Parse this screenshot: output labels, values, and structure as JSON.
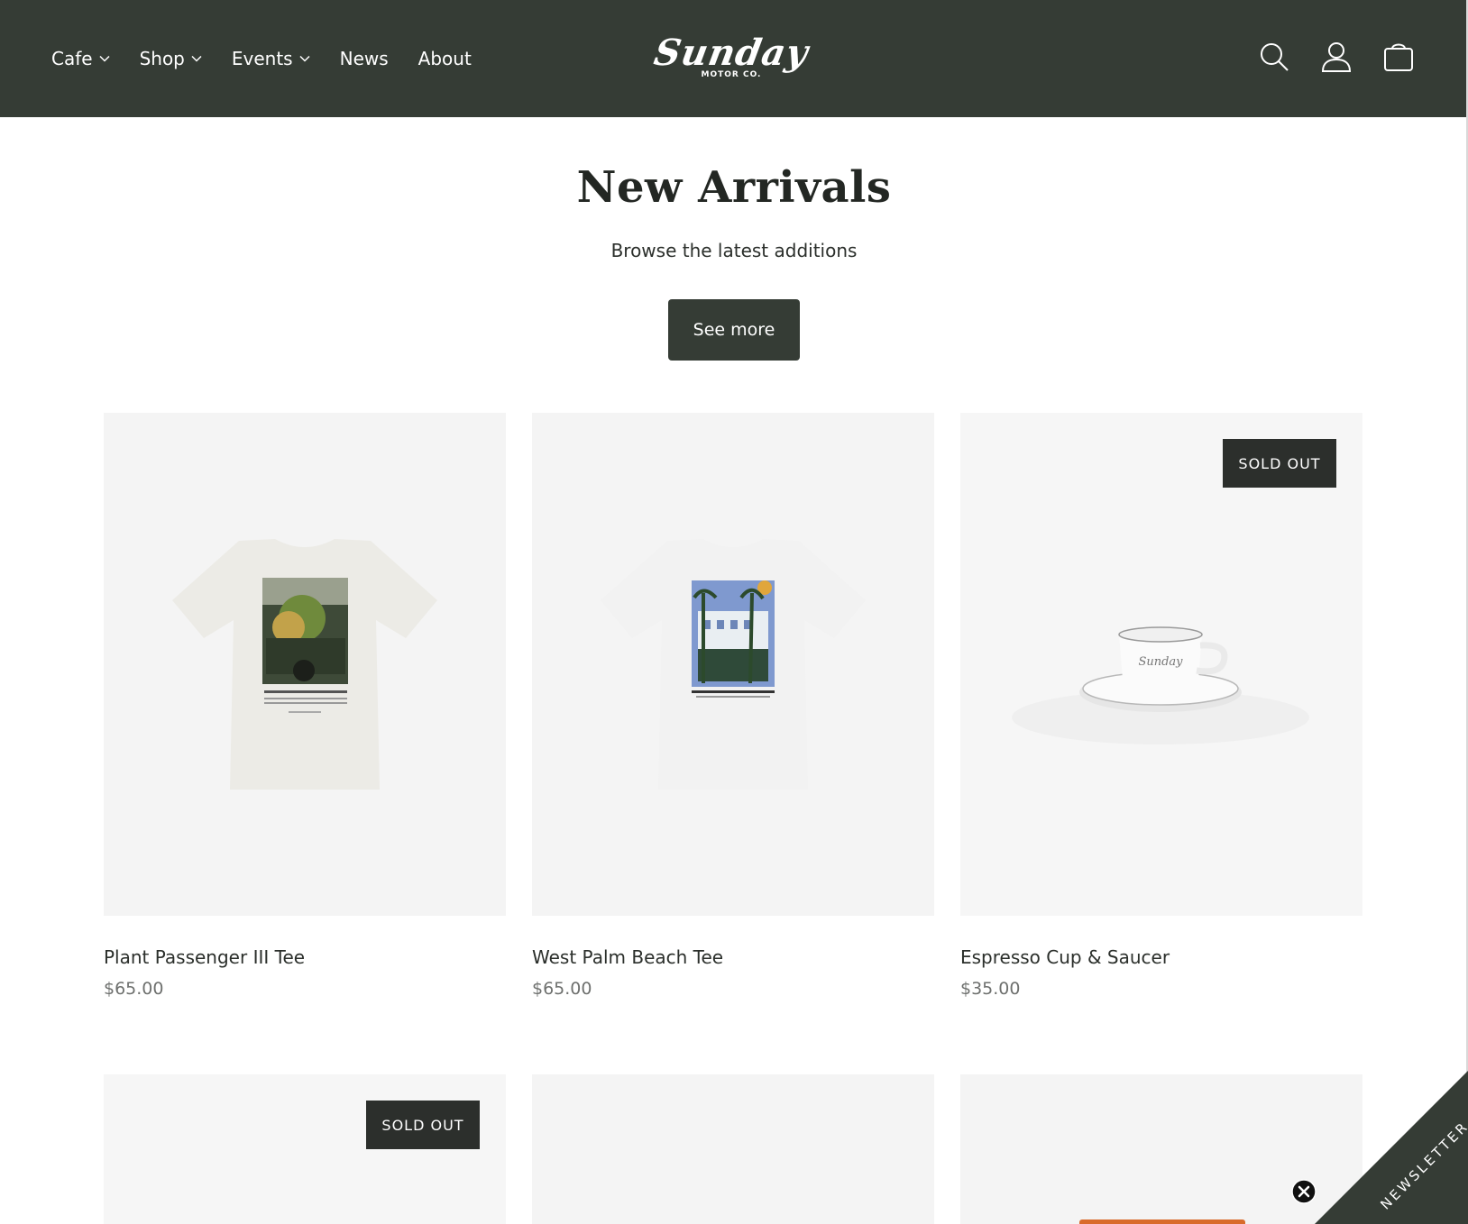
{
  "header": {
    "nav": [
      {
        "label": "Cafe",
        "has_dropdown": true
      },
      {
        "label": "Shop",
        "has_dropdown": true
      },
      {
        "label": "Events",
        "has_dropdown": true
      },
      {
        "label": "News",
        "has_dropdown": false
      },
      {
        "label": "About",
        "has_dropdown": false
      }
    ],
    "logo": {
      "script": "Sunday",
      "sub": "MOTOR CO."
    },
    "icons": [
      "search-icon",
      "account-icon",
      "cart-icon"
    ]
  },
  "hero": {
    "title": "New Arrivals",
    "subtitle": "Browse the latest additions",
    "button_label": "See more"
  },
  "products": [
    {
      "title": "Plant Passenger III Tee",
      "price": "$65.00",
      "sold_out": false
    },
    {
      "title": "West Palm Beach Tee",
      "price": "$65.00",
      "sold_out": false
    },
    {
      "title": "Espresso Cup & Saucer",
      "price": "$35.00",
      "sold_out": true,
      "badge": "SOLD OUT"
    }
  ],
  "products_row2": [
    {
      "sold_out": true,
      "badge": "SOLD OUT"
    },
    {
      "sold_out": false
    },
    {
      "sold_out": false
    }
  ],
  "newsletter": {
    "label": "NEWSLETTER"
  },
  "colors": {
    "header_bg": "#353c35",
    "button_bg": "#353c35",
    "badge_bg": "#2c2f2c",
    "card_bg": "#f4f4f4"
  }
}
